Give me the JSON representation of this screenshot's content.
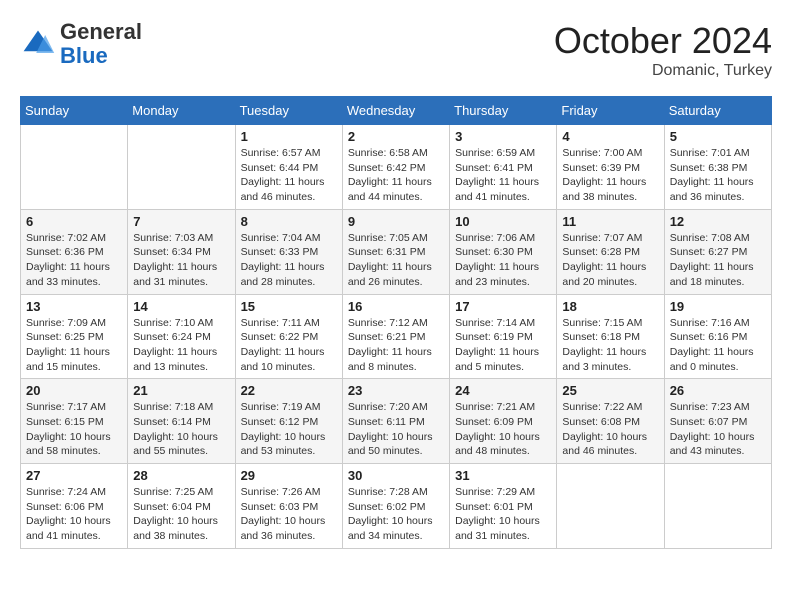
{
  "header": {
    "logo": {
      "line1": "General",
      "line2": "Blue"
    },
    "month": "October 2024",
    "location": "Domanic, Turkey"
  },
  "weekdays": [
    "Sunday",
    "Monday",
    "Tuesday",
    "Wednesday",
    "Thursday",
    "Friday",
    "Saturday"
  ],
  "weeks": [
    [
      null,
      null,
      {
        "day": "1",
        "sunrise": "6:57 AM",
        "sunset": "6:44 PM",
        "daylight": "11 hours and 46 minutes."
      },
      {
        "day": "2",
        "sunrise": "6:58 AM",
        "sunset": "6:42 PM",
        "daylight": "11 hours and 44 minutes."
      },
      {
        "day": "3",
        "sunrise": "6:59 AM",
        "sunset": "6:41 PM",
        "daylight": "11 hours and 41 minutes."
      },
      {
        "day": "4",
        "sunrise": "7:00 AM",
        "sunset": "6:39 PM",
        "daylight": "11 hours and 38 minutes."
      },
      {
        "day": "5",
        "sunrise": "7:01 AM",
        "sunset": "6:38 PM",
        "daylight": "11 hours and 36 minutes."
      }
    ],
    [
      {
        "day": "6",
        "sunrise": "7:02 AM",
        "sunset": "6:36 PM",
        "daylight": "11 hours and 33 minutes."
      },
      {
        "day": "7",
        "sunrise": "7:03 AM",
        "sunset": "6:34 PM",
        "daylight": "11 hours and 31 minutes."
      },
      {
        "day": "8",
        "sunrise": "7:04 AM",
        "sunset": "6:33 PM",
        "daylight": "11 hours and 28 minutes."
      },
      {
        "day": "9",
        "sunrise": "7:05 AM",
        "sunset": "6:31 PM",
        "daylight": "11 hours and 26 minutes."
      },
      {
        "day": "10",
        "sunrise": "7:06 AM",
        "sunset": "6:30 PM",
        "daylight": "11 hours and 23 minutes."
      },
      {
        "day": "11",
        "sunrise": "7:07 AM",
        "sunset": "6:28 PM",
        "daylight": "11 hours and 20 minutes."
      },
      {
        "day": "12",
        "sunrise": "7:08 AM",
        "sunset": "6:27 PM",
        "daylight": "11 hours and 18 minutes."
      }
    ],
    [
      {
        "day": "13",
        "sunrise": "7:09 AM",
        "sunset": "6:25 PM",
        "daylight": "11 hours and 15 minutes."
      },
      {
        "day": "14",
        "sunrise": "7:10 AM",
        "sunset": "6:24 PM",
        "daylight": "11 hours and 13 minutes."
      },
      {
        "day": "15",
        "sunrise": "7:11 AM",
        "sunset": "6:22 PM",
        "daylight": "11 hours and 10 minutes."
      },
      {
        "day": "16",
        "sunrise": "7:12 AM",
        "sunset": "6:21 PM",
        "daylight": "11 hours and 8 minutes."
      },
      {
        "day": "17",
        "sunrise": "7:14 AM",
        "sunset": "6:19 PM",
        "daylight": "11 hours and 5 minutes."
      },
      {
        "day": "18",
        "sunrise": "7:15 AM",
        "sunset": "6:18 PM",
        "daylight": "11 hours and 3 minutes."
      },
      {
        "day": "19",
        "sunrise": "7:16 AM",
        "sunset": "6:16 PM",
        "daylight": "11 hours and 0 minutes."
      }
    ],
    [
      {
        "day": "20",
        "sunrise": "7:17 AM",
        "sunset": "6:15 PM",
        "daylight": "10 hours and 58 minutes."
      },
      {
        "day": "21",
        "sunrise": "7:18 AM",
        "sunset": "6:14 PM",
        "daylight": "10 hours and 55 minutes."
      },
      {
        "day": "22",
        "sunrise": "7:19 AM",
        "sunset": "6:12 PM",
        "daylight": "10 hours and 53 minutes."
      },
      {
        "day": "23",
        "sunrise": "7:20 AM",
        "sunset": "6:11 PM",
        "daylight": "10 hours and 50 minutes."
      },
      {
        "day": "24",
        "sunrise": "7:21 AM",
        "sunset": "6:09 PM",
        "daylight": "10 hours and 48 minutes."
      },
      {
        "day": "25",
        "sunrise": "7:22 AM",
        "sunset": "6:08 PM",
        "daylight": "10 hours and 46 minutes."
      },
      {
        "day": "26",
        "sunrise": "7:23 AM",
        "sunset": "6:07 PM",
        "daylight": "10 hours and 43 minutes."
      }
    ],
    [
      {
        "day": "27",
        "sunrise": "7:24 AM",
        "sunset": "6:06 PM",
        "daylight": "10 hours and 41 minutes."
      },
      {
        "day": "28",
        "sunrise": "7:25 AM",
        "sunset": "6:04 PM",
        "daylight": "10 hours and 38 minutes."
      },
      {
        "day": "29",
        "sunrise": "7:26 AM",
        "sunset": "6:03 PM",
        "daylight": "10 hours and 36 minutes."
      },
      {
        "day": "30",
        "sunrise": "7:28 AM",
        "sunset": "6:02 PM",
        "daylight": "10 hours and 34 minutes."
      },
      {
        "day": "31",
        "sunrise": "7:29 AM",
        "sunset": "6:01 PM",
        "daylight": "10 hours and 31 minutes."
      },
      null,
      null
    ]
  ]
}
